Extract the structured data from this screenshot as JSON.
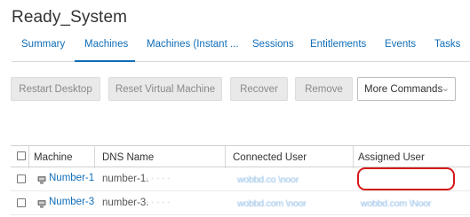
{
  "page_title": "Ready_System",
  "tabs": [
    "Summary",
    "Machines",
    "Machines (Instant ...",
    "Sessions",
    "Entitlements",
    "Events",
    "Tasks"
  ],
  "toolbar": {
    "restart_desktop": "Restart Desktop",
    "reset_vm": "Reset Virtual Machine",
    "recover": "Recover",
    "remove": "Remove",
    "more_commands": "More Commands"
  },
  "table": {
    "headers": {
      "machine": "Machine",
      "dns_name": "DNS Name",
      "connected_user": "Connected User",
      "assigned_user": "Assigned User"
    },
    "rows": [
      {
        "machine": "Number-1",
        "dns_name": "number-1.",
        "dns_partial": "·  ·  ·  ·  ·",
        "connected_user": "wobbd.co \\noor",
        "assigned_user": ""
      },
      {
        "machine": "Number-3",
        "dns_name": "number-3.",
        "dns_partial": "·  ·  ·  ·  ·",
        "connected_user": "wobbd.com \\noor",
        "assigned_user": "wobbd.com \\Noor"
      }
    ]
  },
  "colors": {
    "link": "#0f6db8",
    "highlight": "#d6191b"
  }
}
